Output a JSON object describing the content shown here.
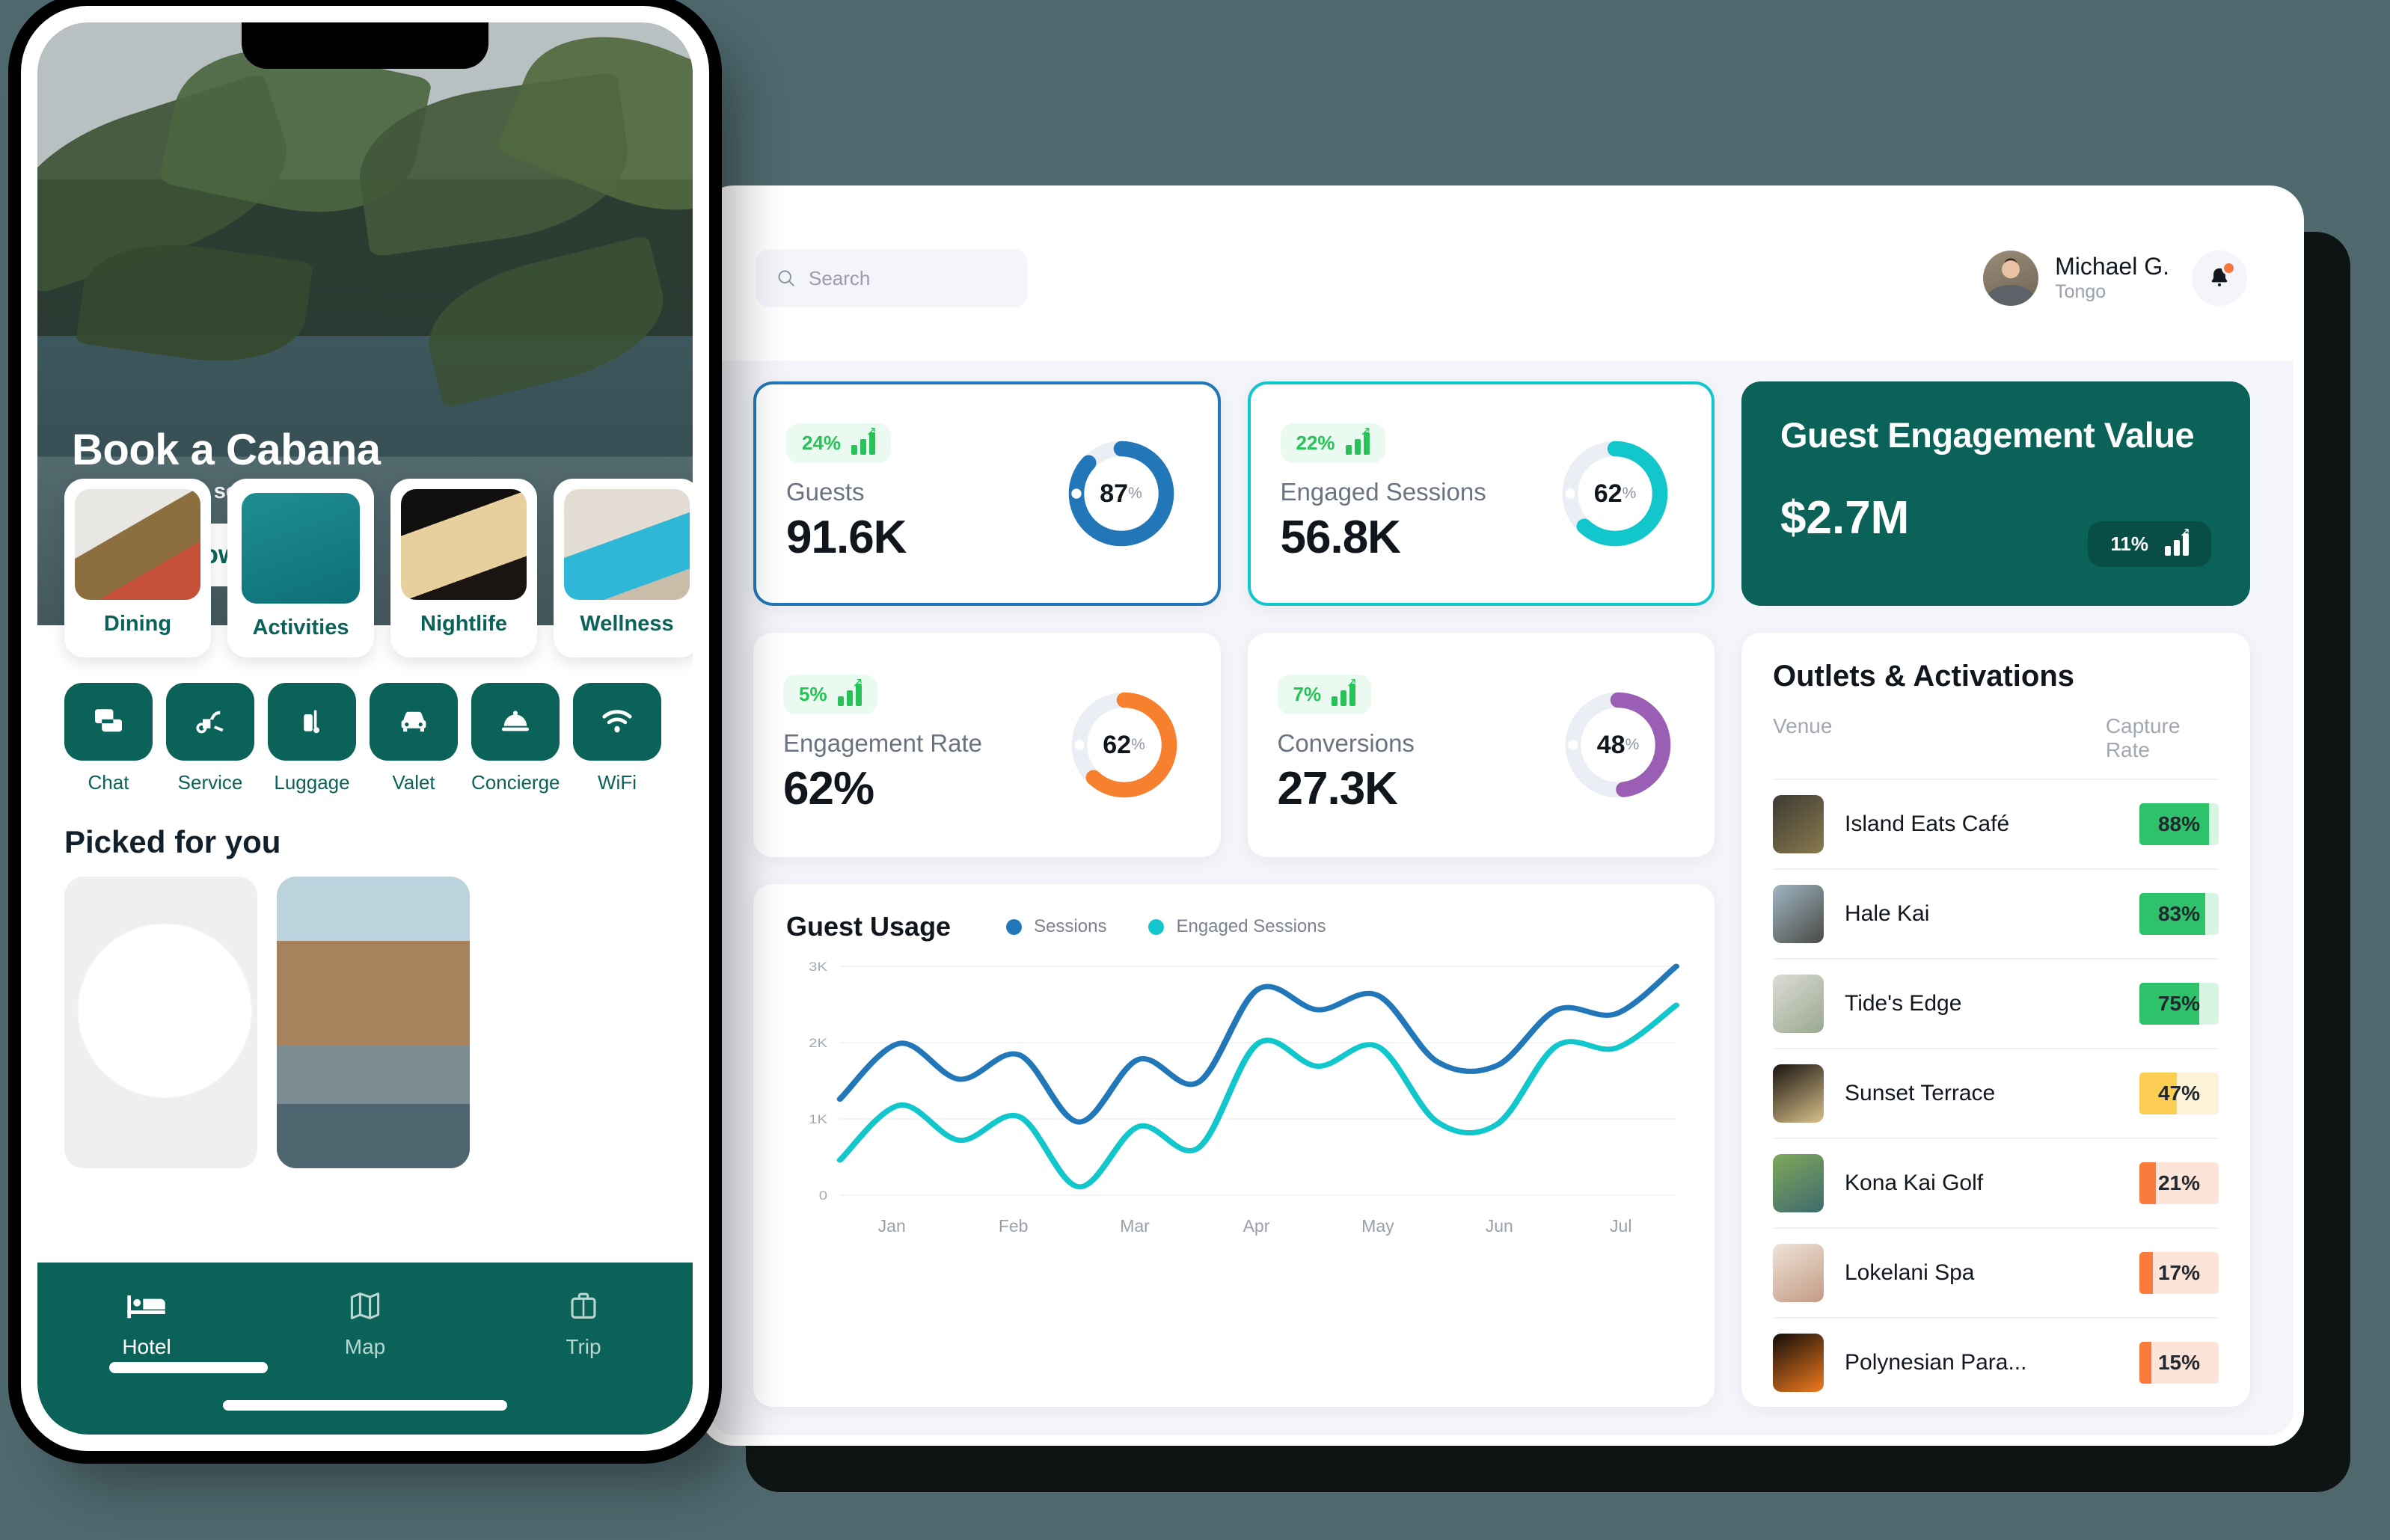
{
  "background_color": "#4e686d",
  "tablet": {
    "header": {
      "search": {
        "placeholder": "Search",
        "icon": "search-icon"
      },
      "user": {
        "name": "Michael G.",
        "org": "Tongo",
        "avatar": "user-avatar"
      },
      "notifications": {
        "icon": "bell-icon",
        "has_unread": true,
        "dot_color": "#f4773b"
      }
    },
    "kpi_cards": [
      {
        "id": "guests",
        "delta": "24%",
        "label": "Guests",
        "value": "91.6K",
        "donut_pct": 87,
        "donut_label": "87",
        "donut_unit": "%",
        "color": "#2277b8",
        "track": "#eceef5",
        "selected": true,
        "select_style": "sel-blue"
      },
      {
        "id": "engaged-sessions",
        "delta": "22%",
        "label": "Engaged Sessions",
        "value": "56.8K",
        "donut_pct": 62,
        "donut_label": "62",
        "donut_unit": "%",
        "color": "#11c7cc",
        "track": "#eceef5",
        "selected": true,
        "select_style": "sel-teal"
      },
      {
        "id": "engagement-rate",
        "delta": "5%",
        "label": "Engagement Rate",
        "value": "62%",
        "donut_pct": 62,
        "donut_label": "62",
        "donut_unit": "%",
        "color": "#f7802f",
        "track": "#eceef5",
        "selected": false,
        "select_style": ""
      },
      {
        "id": "conversions",
        "delta": "7%",
        "label": "Conversions",
        "value": "27.3K",
        "donut_pct": 48,
        "donut_label": "48",
        "donut_unit": "%",
        "color": "#9a5fb4",
        "track": "#eceef5",
        "selected": false,
        "select_style": ""
      }
    ],
    "hero_card": {
      "title": "Guest Engagement Value",
      "value": "$2.7M",
      "delta": "11%",
      "bg_color": "#0b6259",
      "badge_color": "#084d46"
    },
    "outlets": {
      "title": "Outlets & Activations",
      "columns": {
        "venue": "Venue",
        "rate": "Capture Rate"
      },
      "rows": [
        {
          "venue": "Island Eats Café",
          "pct": "88%",
          "value": 88,
          "fill": "#2ec26b",
          "track": "#d6f5e3",
          "thumb": "food-bowls-thumb"
        },
        {
          "venue": "Hale Kai",
          "pct": "83%",
          "value": 83,
          "fill": "#2ec26b",
          "track": "#d6f5e3",
          "thumb": "seafood-plate-thumb"
        },
        {
          "venue": "Tide's Edge",
          "pct": "75%",
          "value": 75,
          "fill": "#2ec26b",
          "track": "#d6f5e3",
          "thumb": "shared-plates-thumb"
        },
        {
          "venue": "Sunset Terrace",
          "pct": "47%",
          "value": 47,
          "fill": "#fccd53",
          "track": "#fdf3d8",
          "thumb": "cocktail-thumb"
        },
        {
          "venue": "Kona Kai Golf",
          "pct": "21%",
          "value": 21,
          "fill": "#fb7b3c",
          "track": "#fde4d8",
          "thumb": "golf-course-thumb"
        },
        {
          "venue": "Lokelani Spa",
          "pct": "17%",
          "value": 17,
          "fill": "#fb7b3c",
          "track": "#fde4d8",
          "thumb": "spa-massage-thumb"
        },
        {
          "venue": "Polynesian Para...",
          "pct": "15%",
          "value": 15,
          "fill": "#fb7b3c",
          "track": "#fde4d8",
          "thumb": "fire-dance-thumb"
        }
      ]
    },
    "chart_data": {
      "type": "line",
      "title": "Guest Usage",
      "xlabel": "",
      "ylabel": "",
      "ylim": [
        0,
        3000
      ],
      "yticks": [
        "0",
        "1K",
        "2K",
        "3K"
      ],
      "grid": true,
      "legend_position": "top",
      "x": [
        "Jan",
        "Feb",
        "Mar",
        "Apr",
        "May",
        "Jun",
        "Jul"
      ],
      "series": [
        {
          "name": "Sessions",
          "color": "#2277b8",
          "values": [
            1260,
            1990,
            1520,
            1840,
            960,
            1780,
            1480,
            2700,
            2430,
            2620,
            1750,
            1700,
            2430,
            2380,
            3000
          ]
        },
        {
          "name": "Engaged Sessions",
          "color": "#11c7cc",
          "values": [
            460,
            1180,
            720,
            1030,
            110,
            900,
            620,
            1990,
            1690,
            1950,
            960,
            930,
            1960,
            1930,
            2490
          ]
        }
      ]
    }
  },
  "phone": {
    "hero": {
      "title": "Book a Cabana",
      "subtitle": "With full F&B service",
      "cta": "Book Now"
    },
    "categories": [
      {
        "label": "Dining",
        "image": "plated-dish",
        "active": false
      },
      {
        "label": "Activities",
        "image": "kayaks-aerial",
        "active": true
      },
      {
        "label": "Nightlife",
        "image": "cocktails-bar",
        "active": false
      },
      {
        "label": "Wellness",
        "image": "spa-pool",
        "active": false
      }
    ],
    "services": [
      {
        "label": "Chat",
        "icon": "chat-icon"
      },
      {
        "label": "Service",
        "icon": "vacuum-icon"
      },
      {
        "label": "Luggage",
        "icon": "luggage-icon"
      },
      {
        "label": "Valet",
        "icon": "car-icon"
      },
      {
        "label": "Concierge",
        "icon": "bell-cloche-icon"
      },
      {
        "label": "WiFi",
        "icon": "wifi-icon"
      }
    ],
    "picked": {
      "title": "Picked for you",
      "cards": [
        {
          "image": "gourmet-plate"
        },
        {
          "image": "surfer-wave"
        }
      ]
    },
    "bottom_nav": [
      {
        "label": "Hotel",
        "icon": "bed-icon",
        "active": true
      },
      {
        "label": "Map",
        "icon": "map-icon",
        "active": false
      },
      {
        "label": "Trip",
        "icon": "suitcase-icon",
        "active": false
      }
    ]
  }
}
